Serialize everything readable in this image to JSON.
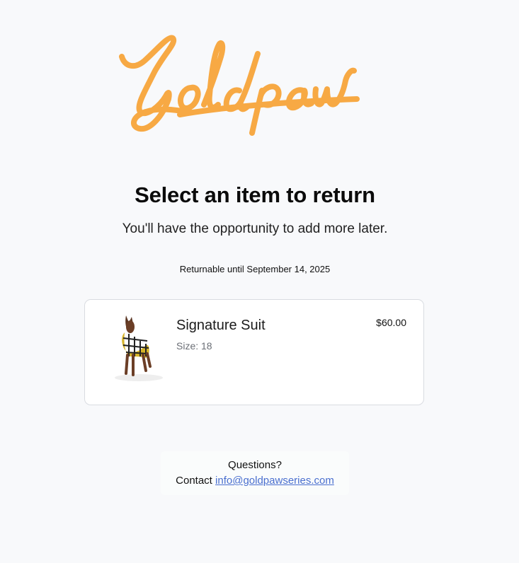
{
  "brand": {
    "logo_text": "Goldpaw",
    "logo_color": "#f7a944"
  },
  "header": {
    "title": "Select an item to return",
    "subtitle": "You'll have the opportunity to add more later."
  },
  "returnable_note": "Returnable until September 14, 2025",
  "items": [
    {
      "name": "Signature Suit",
      "size_label": "Size: 18",
      "price": "$60.00",
      "image_icon": "dog-in-plaid-suit-image"
    }
  ],
  "footer": {
    "question": "Questions?",
    "contact_prefix": "Contact",
    "email": "info@goldpawseries.com"
  }
}
